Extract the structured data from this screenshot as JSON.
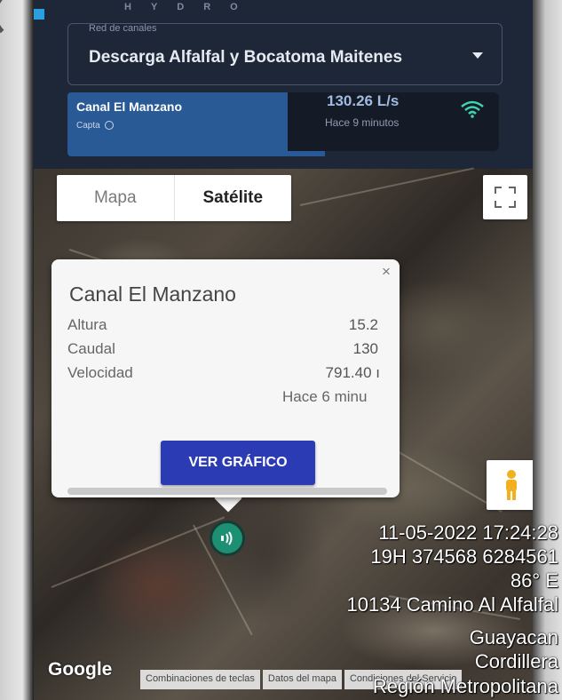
{
  "header": {
    "brand": "HYDRO",
    "select_label": "Red de canales",
    "select_value": "Descarga Alfalfal y Bocatoma Maitenes",
    "station_name": "Canal El Manzano",
    "station_sub": "Capta",
    "reading_value": "130.26 L/s",
    "reading_time": "Hace 9 minutos"
  },
  "map": {
    "toggle_map": "Mapa",
    "toggle_satellite": "Satélite",
    "google_logo": "Google",
    "footer": [
      "Combinaciones de teclas",
      "Datos del mapa",
      "Condiciones del Servicio"
    ]
  },
  "infowindow": {
    "close": "×",
    "title": "Canal El Manzano",
    "rows": [
      {
        "label": "Altura",
        "value": "15.2"
      },
      {
        "label": "Caudal",
        "value": "130"
      },
      {
        "label": "Velocidad",
        "value": "791.40 ı"
      }
    ],
    "time": "Hace 6 minu",
    "button": "VER GRÁFICO"
  },
  "stamp": [
    "11-05-2022 17:24:28",
    "19H 374568 6284561",
    "86° E",
    "10134 Camino Al Alfalfal",
    "Guayacan",
    "Cordillera",
    "Región Metropolitana"
  ],
  "colors": {
    "header_bg": "#1d2738",
    "station_card": "#2a5a96",
    "button_blue": "#2b3bb4",
    "marker_green": "#1d8f72"
  }
}
